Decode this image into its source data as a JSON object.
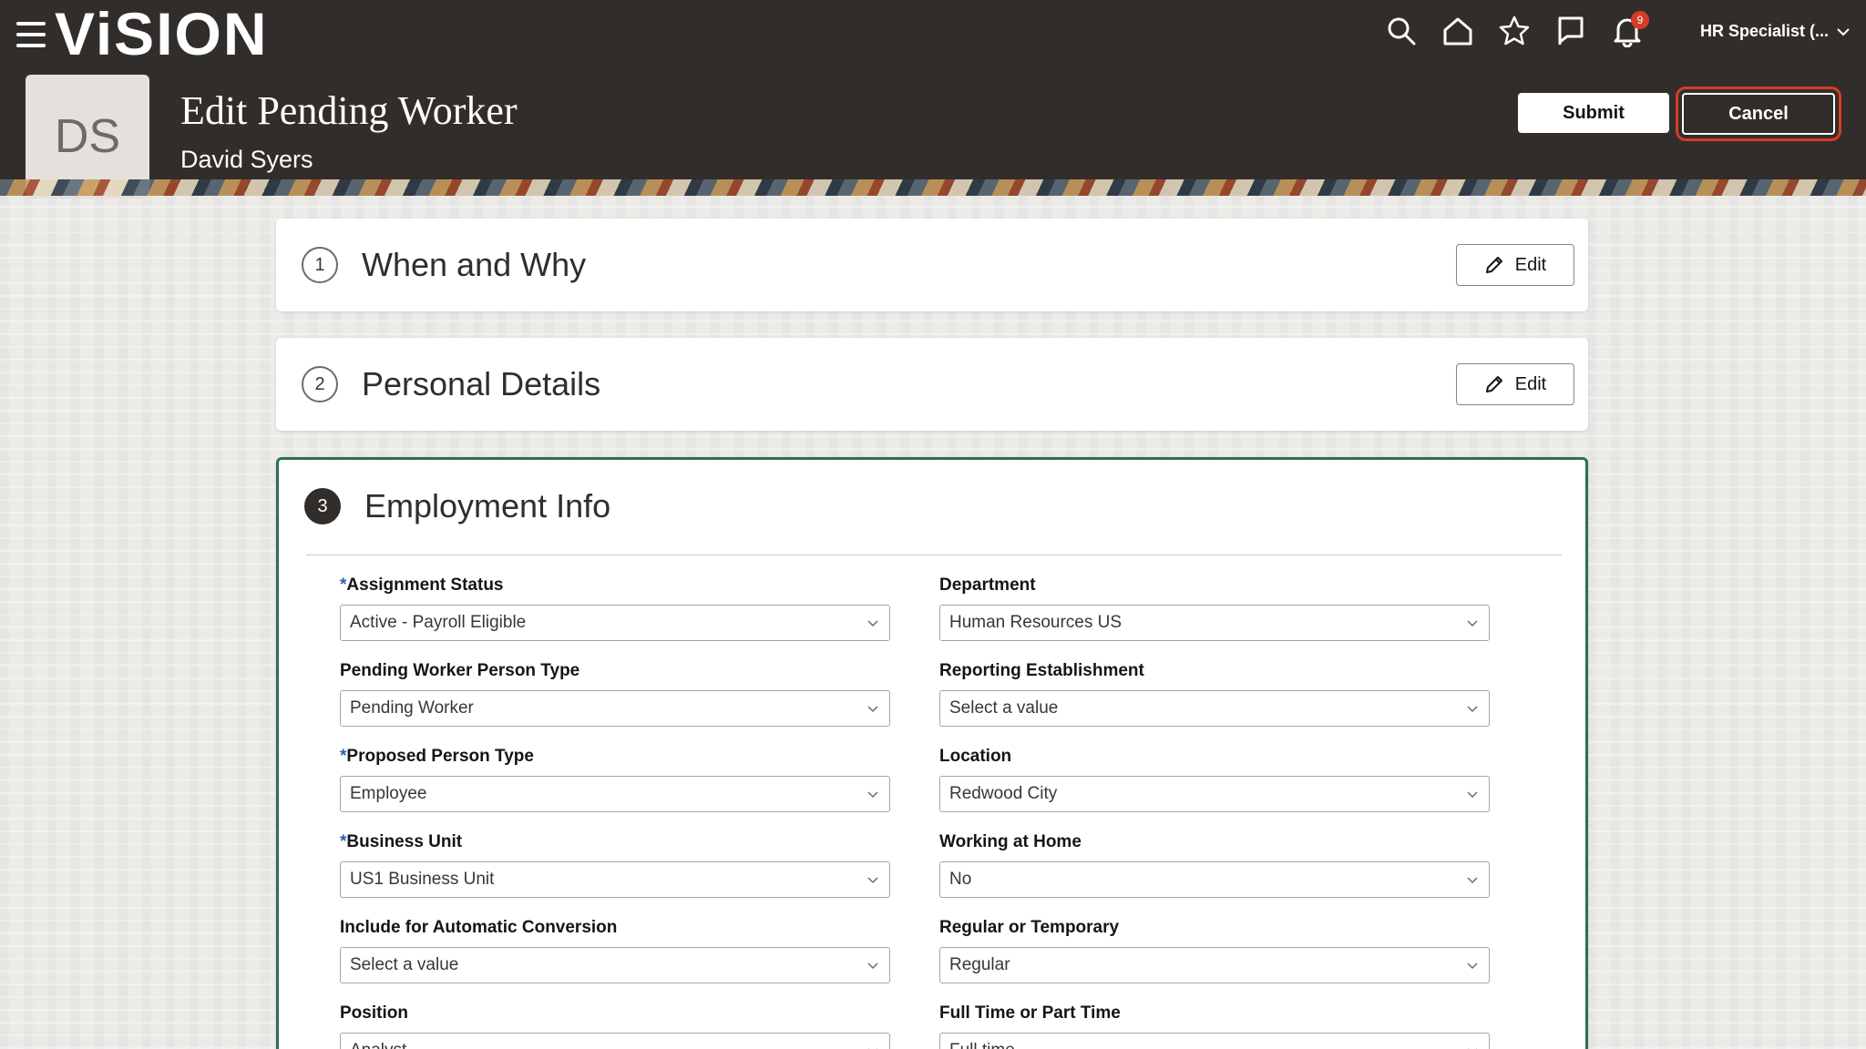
{
  "header": {
    "logo": "ViSION",
    "user_menu": "HR Specialist (...",
    "notification_count": "9",
    "icons": [
      "search-icon",
      "home-icon",
      "star-icon",
      "flag-icon",
      "bell-icon"
    ],
    "avatar_initials": "DS",
    "title": "Edit Pending Worker",
    "subtitle": "David Syers",
    "submit_label": "Submit",
    "cancel_label": "Cancel"
  },
  "sections": [
    {
      "number": "1",
      "title": "When and Why",
      "edit_label": "Edit"
    },
    {
      "number": "2",
      "title": "Personal Details",
      "edit_label": "Edit"
    },
    {
      "number": "3",
      "title": "Employment Info"
    }
  ],
  "fields": [
    {
      "label": "Assignment Status",
      "required": "*",
      "value": "Active - Payroll Eligible"
    },
    {
      "label": "Department",
      "value": "Human Resources US"
    },
    {
      "label": "Pending Worker Person Type",
      "value": "Pending Worker"
    },
    {
      "label": "Reporting Establishment",
      "value": "Select a value"
    },
    {
      "label": "Proposed Person Type",
      "required": "*",
      "value": "Employee"
    },
    {
      "label": "Location",
      "value": "Redwood City"
    },
    {
      "label": "Business Unit",
      "required": "*",
      "value": "US1 Business Unit"
    },
    {
      "label": "Working at Home",
      "value": "No"
    },
    {
      "label": "Include for Automatic Conversion",
      "value": "Select a value"
    },
    {
      "label": "Regular or Temporary",
      "value": "Regular"
    },
    {
      "label": "Position",
      "value": "Analyst"
    },
    {
      "label": "Full Time or Part Time",
      "value": "Full time"
    }
  ],
  "colors": {
    "header_bg": "#312d2a",
    "active_border": "#2f6e52",
    "highlight": "#d63b25",
    "required": "#2b5fb4"
  }
}
